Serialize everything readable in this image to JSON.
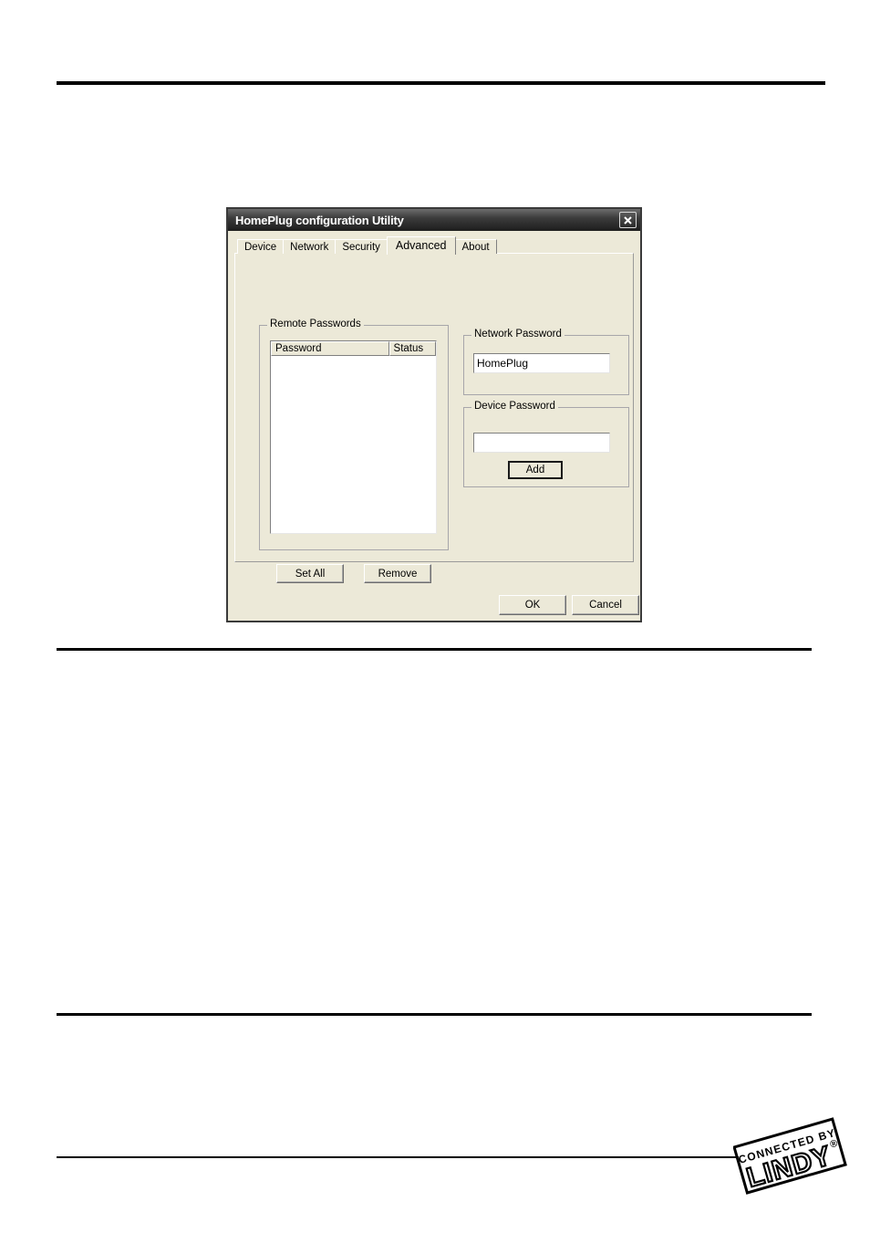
{
  "page": {
    "background": "#ffffff",
    "rules": [
      {
        "name": "rule-top"
      },
      {
        "name": "rule-mid"
      },
      {
        "name": "rule-lower"
      },
      {
        "name": "rule-bottom"
      }
    ]
  },
  "dialog": {
    "title": "HomePlug configuration Utility",
    "close_icon": "close-icon",
    "background": "#ece9d8",
    "titlebar_color": "#2a2a2a",
    "tabs": [
      {
        "label": "Device",
        "active": false
      },
      {
        "label": "Network",
        "active": false
      },
      {
        "label": "Security",
        "active": false
      },
      {
        "label": "Advanced",
        "active": true
      },
      {
        "label": "About",
        "active": false
      }
    ],
    "advanced": {
      "remote_passwords": {
        "group_label": "Remote Passwords",
        "columns": [
          "Password",
          "Status"
        ],
        "rows": []
      },
      "network_password": {
        "group_label": "Network Password",
        "value": "HomePlug",
        "placeholder": ""
      },
      "device_password": {
        "group_label": "Device Password",
        "value": "",
        "placeholder": "",
        "add_label": "Add"
      },
      "set_all_label": "Set All",
      "remove_label": "Remove"
    },
    "footer": {
      "ok_label": "OK",
      "cancel_label": "Cancel"
    }
  },
  "logo": {
    "line1": "CONNECTED BY",
    "line2": "LINDY",
    "registered": "®"
  }
}
